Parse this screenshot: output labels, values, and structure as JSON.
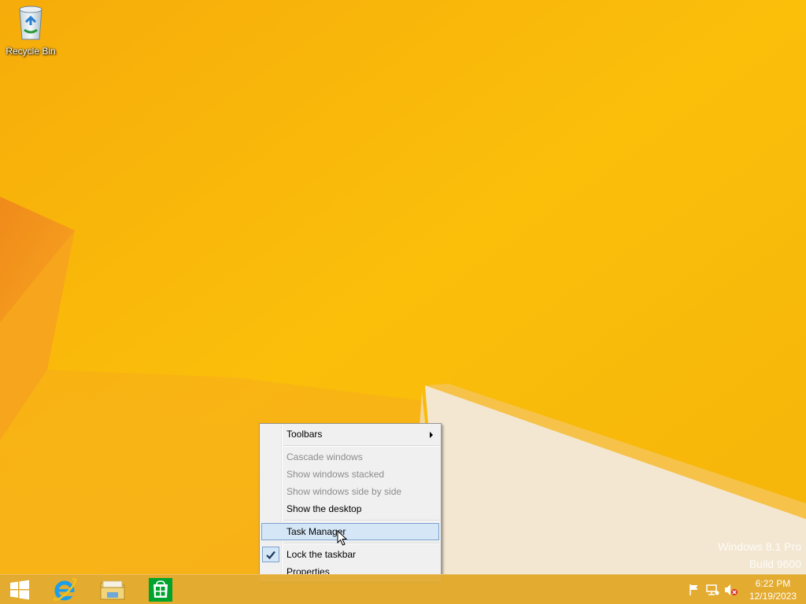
{
  "desktop": {
    "icons": [
      {
        "label": "Recycle Bin",
        "icon": "recycle-bin-icon"
      }
    ],
    "watermark": {
      "line1": "Windows 8.1 Pro",
      "line2": "Build 9600"
    },
    "background_color": "#f7b500"
  },
  "context_menu": {
    "items": [
      {
        "label": "Toolbars",
        "enabled": true,
        "submenu": true
      },
      {
        "label": "Cascade windows",
        "enabled": false
      },
      {
        "label": "Show windows stacked",
        "enabled": false
      },
      {
        "label": "Show windows side by side",
        "enabled": false
      },
      {
        "label": "Show the desktop",
        "enabled": true
      },
      {
        "label": "Task Manager",
        "enabled": true,
        "highlighted": true
      },
      {
        "label": "Lock the taskbar",
        "enabled": true,
        "checked": true
      },
      {
        "label": "Properties",
        "enabled": true
      }
    ]
  },
  "taskbar": {
    "pinned": [
      {
        "name": "start",
        "icon": "windows-logo-icon"
      },
      {
        "name": "internet-explorer",
        "icon": "internet-explorer-icon"
      },
      {
        "name": "file-explorer",
        "icon": "folder-icon"
      },
      {
        "name": "store",
        "icon": "store-icon"
      }
    ],
    "tray": {
      "icons": [
        "flag-icon",
        "network-icon",
        "volume-muted-icon"
      ],
      "time": "6:22 PM",
      "date": "12/19/2023"
    }
  },
  "colors": {
    "accent_blue": "#d5e6f6",
    "highlight_border": "#7da2ce",
    "taskbar": "#e2ab32"
  }
}
